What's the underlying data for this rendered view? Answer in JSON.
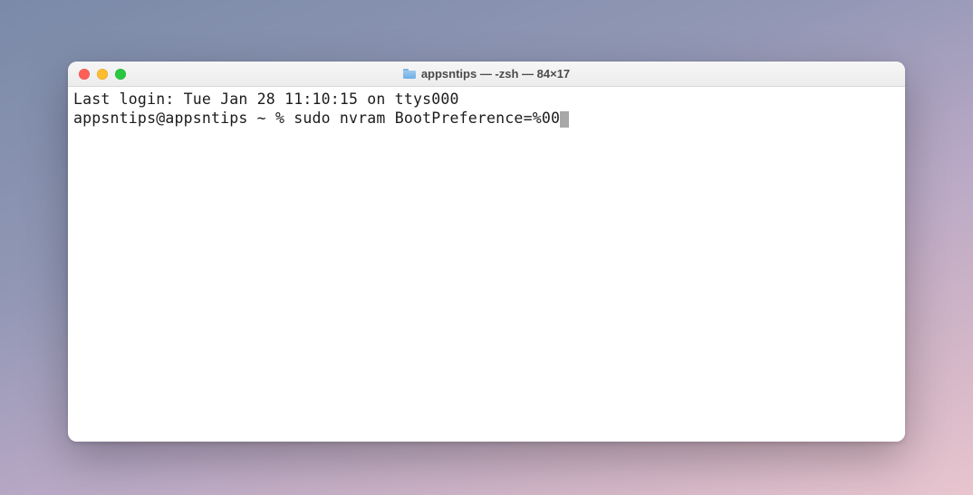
{
  "window": {
    "title": "appsntips — -zsh — 84×17"
  },
  "terminal": {
    "last_login_line": "Last login: Tue Jan 28 11:10:15 on ttys000",
    "prompt": "appsntips@appsntips ~ % ",
    "command": "sudo nvram BootPreference=%00"
  }
}
